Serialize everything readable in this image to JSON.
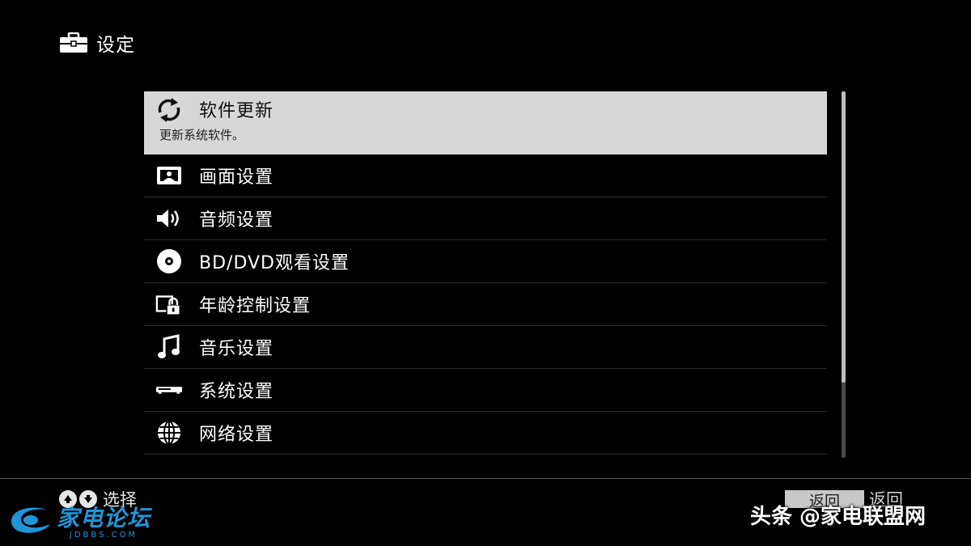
{
  "header": {
    "title": "设定",
    "icon": "toolbox-icon"
  },
  "menu": {
    "items": [
      {
        "label": "软件更新",
        "description": "更新系统软件。",
        "icon": "refresh-icon",
        "selected": true
      },
      {
        "label": "画面设置",
        "icon": "picture-icon"
      },
      {
        "label": "音频设置",
        "icon": "speaker-icon"
      },
      {
        "label": "BD/DVD观看设置",
        "icon": "disc-icon"
      },
      {
        "label": "年龄控制设置",
        "icon": "parental-lock-icon"
      },
      {
        "label": "音乐设置",
        "icon": "music-note-icon"
      },
      {
        "label": "系统设置",
        "icon": "player-device-icon"
      },
      {
        "label": "网络设置",
        "icon": "globe-icon"
      }
    ]
  },
  "footer": {
    "nav_hint": "选择",
    "back_button": "返回",
    "back_label": "返回"
  },
  "watermarks": {
    "logo_cn": "家电论坛",
    "logo_en": "JDBBS.COM",
    "toutiao": "头条 @家电联盟网"
  },
  "colors": {
    "background": "#000000",
    "selected_row": "#d7d7d7",
    "logo_blue": "#1f95d8"
  }
}
